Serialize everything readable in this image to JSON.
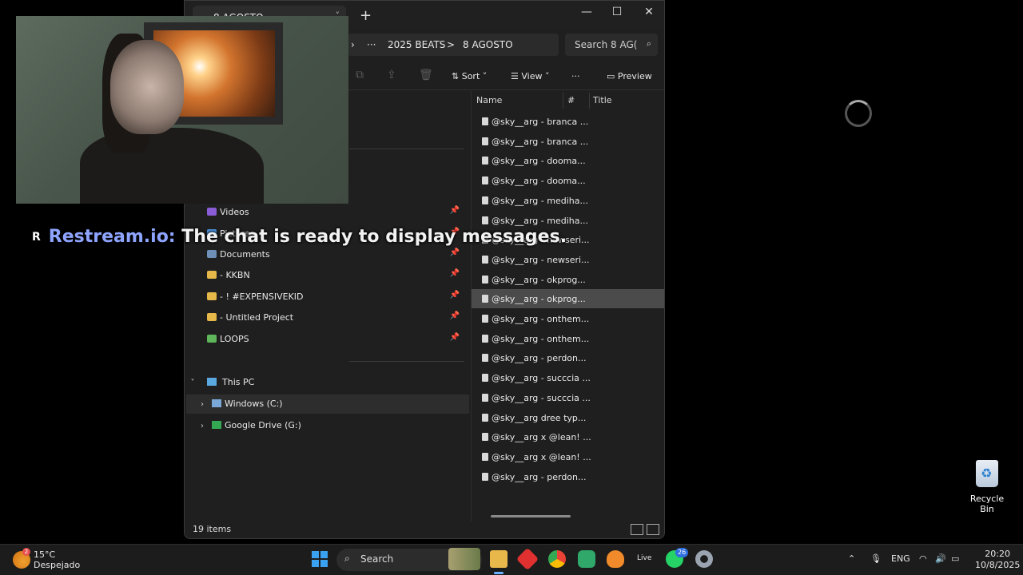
{
  "explorer": {
    "tab_title": "8 AGOSTO",
    "tab_close": "˅",
    "new_tab": "+",
    "window_controls": {
      "minimize": "—",
      "maximize": "☐",
      "close": "✕"
    },
    "breadcrumb": {
      "chevron": "›",
      "overflow": "···",
      "parent": "2025 BEATS",
      "sep": ">",
      "current": "8 AGOSTO"
    },
    "search_placeholder": "Search 8 AG(",
    "toolbar": {
      "sort": "Sort",
      "view": "View",
      "more": "···",
      "preview": "Preview"
    },
    "nav": {
      "items": [
        {
          "label": "Videos",
          "color": "#8a5cd6",
          "pinned": true
        },
        {
          "label": "Pictures",
          "color": "#4a8fd6",
          "pinned": true
        },
        {
          "label": "Documents",
          "color": "#6d8fb8",
          "pinned": true
        },
        {
          "label": "- KKBN",
          "color": "#e6b84a",
          "pinned": true
        },
        {
          "label": "- ! #EXPENSIVEKID",
          "color": "#e6b84a",
          "pinned": true
        },
        {
          "label": "- Untitled Project",
          "color": "#e6b84a",
          "pinned": true
        },
        {
          "label": "LOOPS",
          "color": "#5fb55a",
          "pinned": true
        }
      ],
      "this_pc": "This PC",
      "drives": [
        {
          "label": "Windows (C:)",
          "color": "#7aa8d8"
        },
        {
          "label": "Google Drive (G:)",
          "color": "#34a853"
        }
      ]
    },
    "columns": {
      "name": "Name",
      "number": "#",
      "title": "Title"
    },
    "files": [
      "@sky__arg - branca ...",
      "@sky__arg - branca ...",
      "@sky__arg - dooma...",
      "@sky__arg - dooma...",
      "@sky__arg - mediha...",
      "@sky__arg - mediha...",
      "@sky__arg - newseri...",
      "@sky__arg - newseri...",
      "@sky__arg - okprog...",
      "@sky__arg - okprog...",
      "@sky__arg - onthem...",
      "@sky__arg - onthem...",
      "@sky__arg - perdon...",
      "@sky__arg - succcia ...",
      "@sky__arg - succcia ...",
      "@sky__arg dree typ...",
      "@sky__arg x @lean! ...",
      "@sky__arg x @lean! ...",
      "@sky__arg - perdon..."
    ],
    "selected_index": 9,
    "status": "19 items"
  },
  "chat": {
    "badge": "R",
    "brand": "Restream.io:",
    "message": "The chat is ready to display messages."
  },
  "desktop": {
    "recycle_bin": "Recycle Bin"
  },
  "taskbar": {
    "weather_temp": "15°C",
    "weather_desc": "Despejado",
    "weather_badge": "2",
    "search": "Search",
    "whatsapp_badge": "26",
    "live_label": "Live",
    "lang": "ENG",
    "time": "20:20",
    "date": "10/8/2025"
  }
}
